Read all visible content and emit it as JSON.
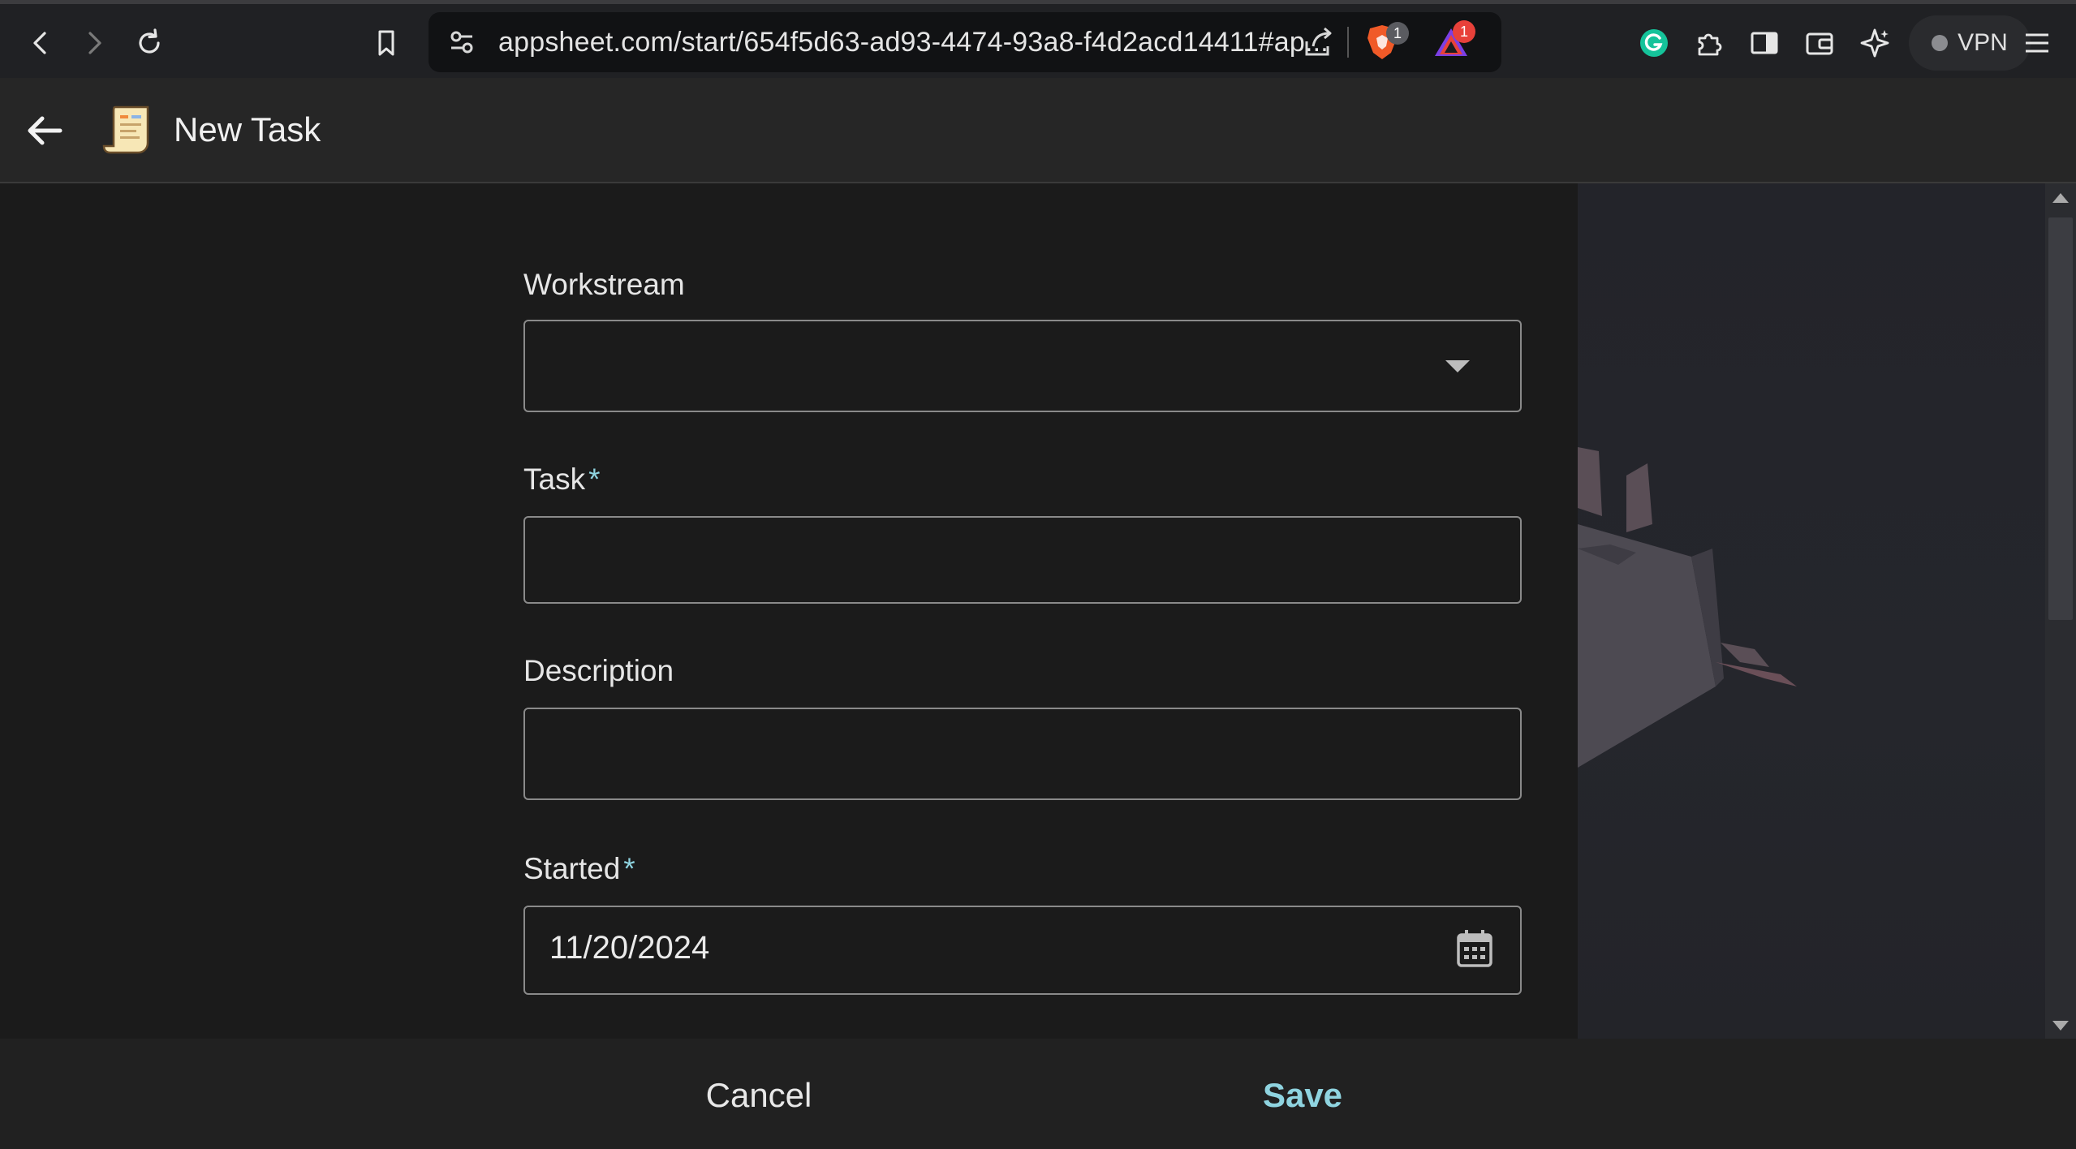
{
  "browser": {
    "url": "appsheet.com/start/654f5d63-ad93-4474-93a8-f4d2acd14411#ap...",
    "brave_badge_count": "1",
    "rewards_badge_count": "1",
    "vpn_label": "VPN"
  },
  "header": {
    "title": "New Task"
  },
  "form": {
    "workstream": {
      "label": "Workstream",
      "value": ""
    },
    "task": {
      "label": "Task",
      "required_mark": "*",
      "value": ""
    },
    "description": {
      "label": "Description",
      "value": ""
    },
    "started": {
      "label": "Started",
      "required_mark": "*",
      "value": "11/20/2024"
    }
  },
  "footer": {
    "cancel_label": "Cancel",
    "save_label": "Save"
  },
  "colors": {
    "accent": "#8fd4e0",
    "background": "#1b1b1b",
    "header": "#262626"
  },
  "icons": [
    "back-icon",
    "forward-icon",
    "reload-icon",
    "bookmark-icon",
    "site-settings-icon",
    "share-icon",
    "brave-shield-icon",
    "brave-rewards-icon",
    "grammarly-icon",
    "extensions-icon",
    "sidebar-icon",
    "wallet-icon",
    "leo-ai-icon",
    "menu-icon",
    "app-back-arrow-icon",
    "app-logo-scroll-icon",
    "dropdown-caret-icon",
    "calendar-icon"
  ]
}
